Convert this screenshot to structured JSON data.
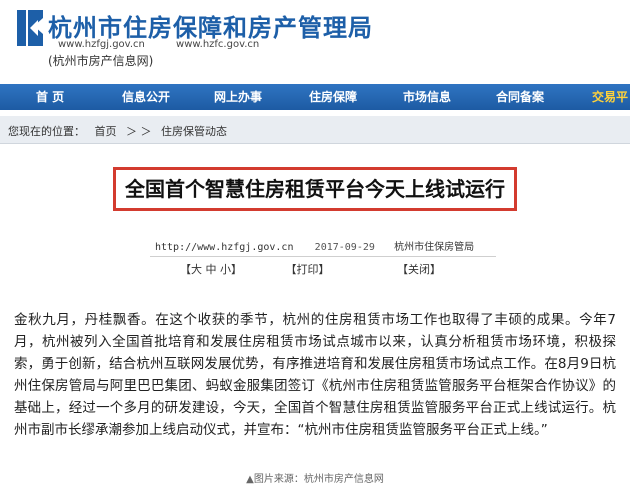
{
  "header": {
    "title": "杭州市住房保障和房产管理局",
    "url1": "www.hzfgj.gov.cn",
    "url2": "www.hzfc.gov.cn",
    "subtitle": "(杭州市房产信息网)"
  },
  "nav": {
    "items": [
      "首 页",
      "信息公开",
      "网上办事",
      "住房保障",
      "市场信息",
      "合同备案",
      "交易平"
    ]
  },
  "breadcrumb": {
    "prefix": "您现在的位置：",
    "home": "首页",
    "sep": "＞ ＞",
    "current": "住房保管动态"
  },
  "article": {
    "title": "全国首个智慧住房租赁平台今天上线试运行",
    "source_url": "http://www.hzfgj.gov.cn",
    "date": "2017-09-29",
    "source": "杭州市住保房管局",
    "font_size_label": "【大  中  小】",
    "print_label": "【打印】",
    "close_label": "【关闭】",
    "body": "金秋九月，丹桂飘香。在这个收获的季节，杭州的住房租赁市场工作也取得了丰硕的成果。今年7月，杭州被列入全国首批培育和发展住房租赁市场试点城市以来，认真分析租赁市场环境，积极探索，勇于创新，结合杭州互联网发展优势，有序推进培育和发展住房租赁市场试点工作。在8月9日杭州住保房管局与阿里巴巴集团、蚂蚁金服集团签订《杭州市住房租赁监管服务平台框架合作协议》的基础上，经过一个多月的研发建设，今天，全国首个智慧住房租赁监管服务平台正式上线试运行。杭州市副市长缪承潮参加上线启动仪式，并宣布：“杭州市住房租赁监管服务平台正式上线。”"
  },
  "caption": "▲图片来源：杭州市房产信息网",
  "colors": {
    "brand_blue": "#1d5fa8",
    "nav_blue": "#2369b5",
    "highlight_red": "#d33b2f"
  }
}
